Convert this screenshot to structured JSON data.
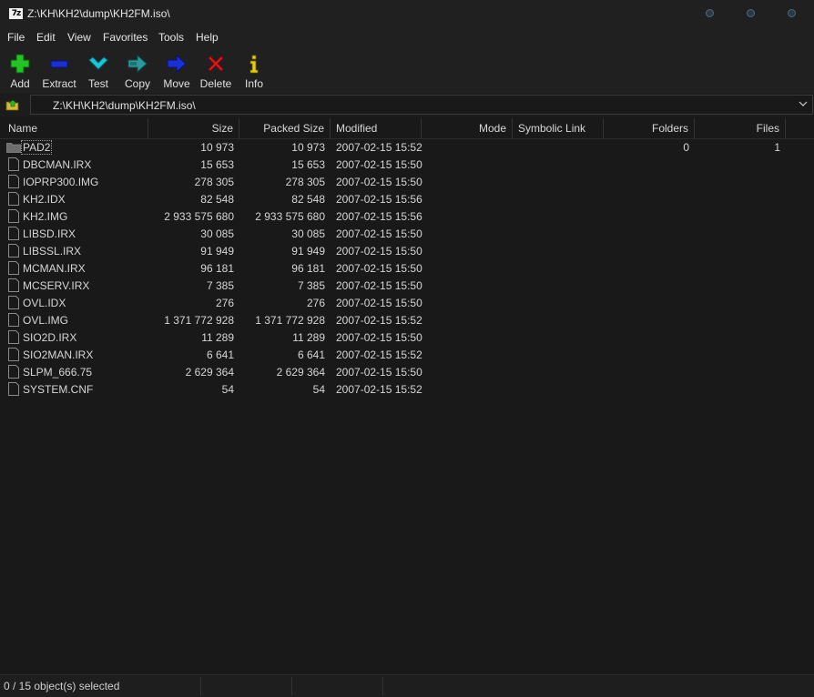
{
  "window": {
    "title": "Z:\\KH\\KH2\\dump\\KH2FM.iso\\",
    "app_icon_text": "7z"
  },
  "menu": [
    "File",
    "Edit",
    "View",
    "Favorites",
    "Tools",
    "Help"
  ],
  "toolbar": {
    "add": "Add",
    "extract": "Extract",
    "test": "Test",
    "copy": "Copy",
    "move": "Move",
    "delete": "Delete",
    "info": "Info"
  },
  "address": {
    "path": "Z:\\KH\\KH2\\dump\\KH2FM.iso\\"
  },
  "columns": {
    "name": "Name",
    "size": "Size",
    "packed": "Packed Size",
    "modified": "Modified",
    "mode": "Mode",
    "symlink": "Symbolic Link",
    "folders": "Folders",
    "files": "Files"
  },
  "rows": [
    {
      "name": "PAD2",
      "size": "10 973",
      "packed": "10 973",
      "modified": "2007-02-15 15:52",
      "folders": "0",
      "files": "1"
    },
    {
      "name": "DBCMAN.IRX",
      "size": "15 653",
      "packed": "15 653",
      "modified": "2007-02-15 15:50"
    },
    {
      "name": "IOPRP300.IMG",
      "size": "278 305",
      "packed": "278 305",
      "modified": "2007-02-15 15:50"
    },
    {
      "name": "KH2.IDX",
      "size": "82 548",
      "packed": "82 548",
      "modified": "2007-02-15 15:56"
    },
    {
      "name": "KH2.IMG",
      "size": "2 933 575 680",
      "packed": "2 933 575 680",
      "modified": "2007-02-15 15:56"
    },
    {
      "name": "LIBSD.IRX",
      "size": "30 085",
      "packed": "30 085",
      "modified": "2007-02-15 15:50"
    },
    {
      "name": "LIBSSL.IRX",
      "size": "91 949",
      "packed": "91 949",
      "modified": "2007-02-15 15:50"
    },
    {
      "name": "MCMAN.IRX",
      "size": "96 181",
      "packed": "96 181",
      "modified": "2007-02-15 15:50"
    },
    {
      "name": "MCSERV.IRX",
      "size": "7 385",
      "packed": "7 385",
      "modified": "2007-02-15 15:50"
    },
    {
      "name": "OVL.IDX",
      "size": "276",
      "packed": "276",
      "modified": "2007-02-15 15:50"
    },
    {
      "name": "OVL.IMG",
      "size": "1 371 772 928",
      "packed": "1 371 772 928",
      "modified": "2007-02-15 15:52"
    },
    {
      "name": "SIO2D.IRX",
      "size": "11 289",
      "packed": "11 289",
      "modified": "2007-02-15 15:50"
    },
    {
      "name": "SIO2MAN.IRX",
      "size": "6 641",
      "packed": "6 641",
      "modified": "2007-02-15 15:52"
    },
    {
      "name": "SLPM_666.75",
      "size": "2 629 364",
      "packed": "2 629 364",
      "modified": "2007-02-15 15:50"
    },
    {
      "name": "SYSTEM.CNF",
      "size": "54",
      "packed": "54",
      "modified": "2007-02-15 15:52"
    }
  ],
  "status": {
    "text": "0 / 15 object(s) selected"
  },
  "colors": {
    "background": "#191919",
    "add": "#22c322",
    "extract": "#1a2fd6",
    "test": "#19c8d8",
    "copy": "#2a9a9a",
    "move": "#1a2fd6",
    "delete": "#e01818",
    "info": "#e8d000"
  }
}
